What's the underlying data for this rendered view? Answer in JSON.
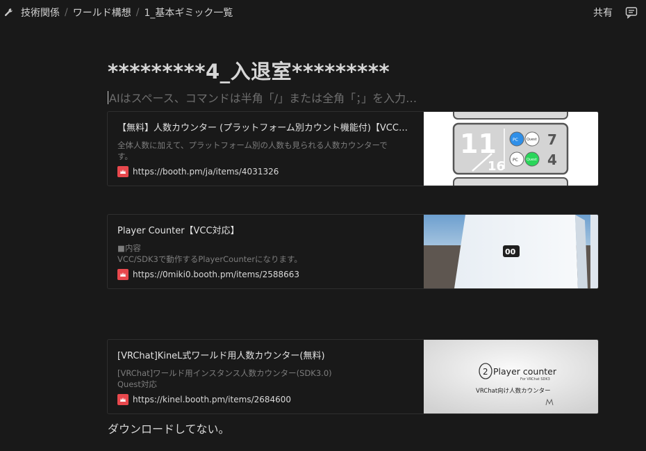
{
  "breadcrumb": {
    "items": [
      "技術関係",
      "ワールド構想",
      "1_基本ギミック一覧"
    ],
    "separator": "/"
  },
  "header": {
    "share_label": "共有"
  },
  "page": {
    "title": "*********4_入退室*********",
    "placeholder": "AIはスペース、コマンドは半角「/」または全角「；」を入力…",
    "footer_text": "ダウンロードしてない。"
  },
  "bookmarks": [
    {
      "title": "【無料】人数カウンター (プラットフォーム別カウント機能付)【VCC対応】",
      "desc_lines": [
        "全体人数に加えて、プラットフォーム別の人数も見られる人数カウンターで",
        "す。"
      ],
      "url": "https://booth.pm/ja/items/4031326",
      "thumb": {
        "total": "11",
        "max": "16",
        "pc_count": "7",
        "quest_count": "4",
        "pc_label": "PC",
        "quest_label": "Quest"
      }
    },
    {
      "title": "Player Counter【VCC対応】",
      "desc_lines": [
        "■内容",
        "VCC/SDK3で動作するPlayerCounterになります。"
      ],
      "url": "https://0miki0.booth.pm/items/2588663",
      "thumb": {
        "display": "00"
      }
    },
    {
      "title": "[VRChat]KineL式ワールド用人数カウンター(無料)",
      "desc_lines": [
        "[VRChat]ワールド用インスタンス人数カウンター(SDK3.0)",
        "Quest対応"
      ],
      "url": "https://kinel.booth.pm/items/2684600",
      "thumb": {
        "number": "2",
        "heading": "Player counter",
        "sub": "For VRChat SDK3",
        "caption": "VRChat向け人数カウンター"
      }
    }
  ]
}
